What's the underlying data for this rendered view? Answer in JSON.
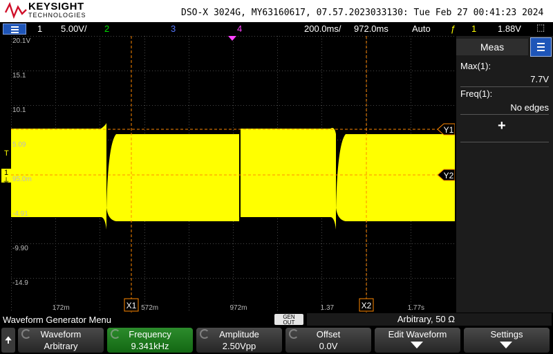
{
  "header": {
    "brand": "KEYSIGHT",
    "brand_sub": "TECHNOLOGIES",
    "title": "DSO-X 3024G, MY63160617, 07.57.2023033130: Tue Feb 27 00:41:23 2024"
  },
  "channel_bar": {
    "ch1": "1",
    "ch1_scale": "5.00V/",
    "ch2": "2",
    "ch3": "3",
    "ch4": "4",
    "timebase": "200.0ms/",
    "delay": "972.0ms",
    "trigger_mode": "Auto",
    "trigger_source": "1",
    "trigger_level": "1.88V",
    "colors": {
      "ch1": "#ffff00",
      "ch2": "#00e000",
      "ch3": "#5577ff",
      "ch4": "#ff44ff"
    }
  },
  "y_ticks": [
    "20.1V",
    "15.1",
    "10.1",
    "5.09",
    "95.0m",
    "-4.91",
    "-9.90",
    "-14.9"
  ],
  "x_ticks": [
    "172m",
    "572m",
    "972m",
    "1.37",
    "1.77s"
  ],
  "cursors": {
    "x1": "X1",
    "x2": "X2",
    "y1": "Y1",
    "y2": "Y2",
    "trigger_marker": "T"
  },
  "meas": {
    "title": "Meas",
    "max_label": "Max(1):",
    "max_value": "7.7V",
    "freq_label": "Freq(1):",
    "freq_value": "No edges",
    "add_icon": "plus-icon"
  },
  "bottom": {
    "menu_title": "Waveform Generator Menu",
    "gen_out_line1": "GEN",
    "gen_out_line2": "OUT",
    "status": "Arbitrary, 50 Ω"
  },
  "softkeys": [
    {
      "label": "Waveform",
      "value": "Arbitrary"
    },
    {
      "label": "Frequency",
      "value": "9.341kHz"
    },
    {
      "label": "Amplitude",
      "value": "2.50Vpp"
    },
    {
      "label": "Offset",
      "value": "0.0V"
    },
    {
      "label": "Edit Waveform",
      "value": ""
    },
    {
      "label": "Settings",
      "value": ""
    }
  ]
}
